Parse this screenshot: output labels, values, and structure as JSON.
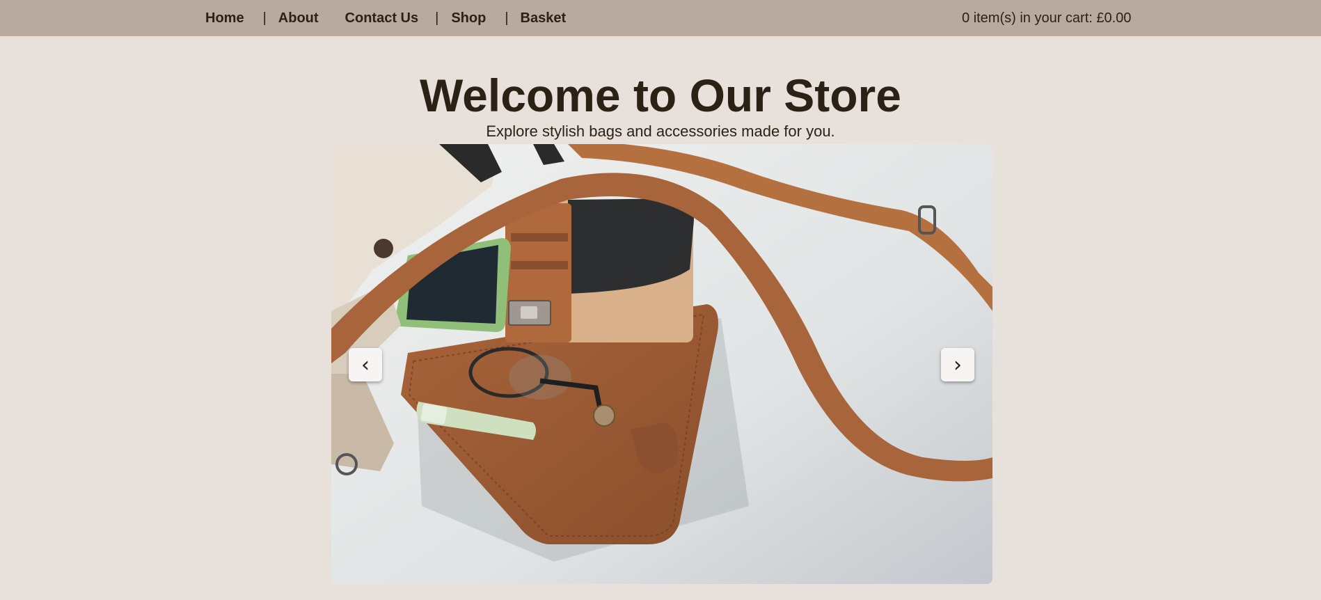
{
  "nav": {
    "items": [
      {
        "label": "Home"
      },
      {
        "label": "About"
      },
      {
        "label": "Contact Us"
      },
      {
        "label": "Shop"
      },
      {
        "label": "Basket"
      }
    ],
    "separator": "|"
  },
  "cart": {
    "summary": "0 item(s) in your cart: £0.00"
  },
  "hero": {
    "title": "Welcome to Our Store",
    "subtitle": "Explore stylish bags and accessories made for you."
  },
  "carousel": {
    "prev_glyph": "‹",
    "next_glyph": "›",
    "prev_icon": "chevron-left-icon",
    "next_icon": "chevron-right-icon"
  },
  "colors": {
    "topbar": "#b8aa9f",
    "page_background": "#e8e0da",
    "text": "#2b2115"
  }
}
